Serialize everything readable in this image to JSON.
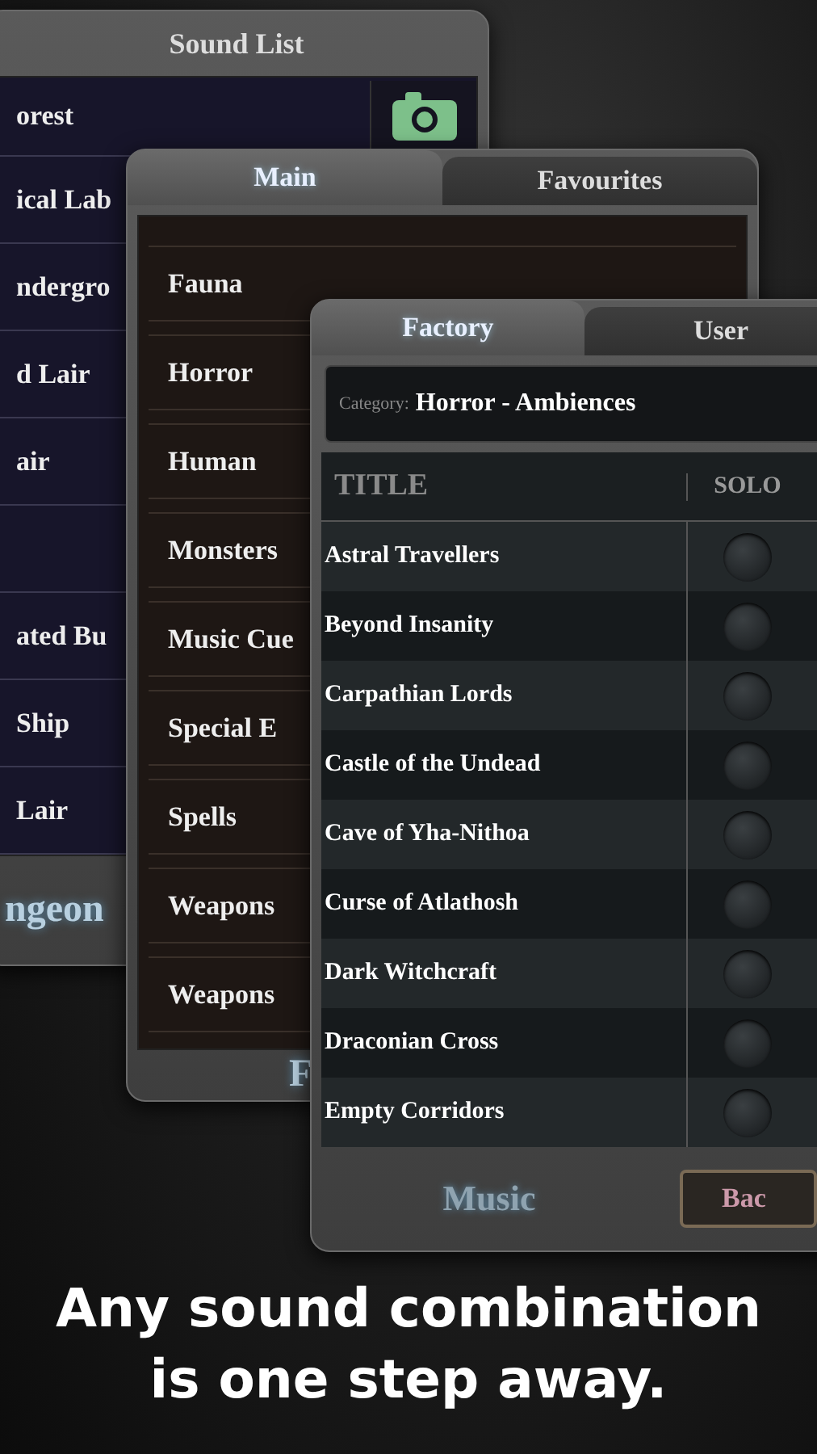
{
  "sound_list": {
    "title": "Sound List",
    "sections": [
      [
        "orest",
        "ical Lab",
        "ndergro",
        "d Lair",
        "air"
      ],
      [
        "ated Bu",
        "Ship",
        "Lair"
      ]
    ],
    "footer": "ngeon"
  },
  "category_panel": {
    "tabs": [
      {
        "label": "Main",
        "selected": true
      },
      {
        "label": "Favourites",
        "selected": false
      }
    ],
    "items": [
      "Fauna",
      "Horror",
      "Human",
      "Monsters",
      "Music Cue",
      "Special E",
      "Spells",
      "Weapons",
      "Weapons"
    ],
    "footer": "F"
  },
  "sounds_panel": {
    "tabs": [
      {
        "label": "Factory",
        "selected": true
      },
      {
        "label": "User",
        "selected": false
      }
    ],
    "category_label": "Category:",
    "category": "Horror - Ambiences",
    "columns": [
      "TITLE",
      "SOLO"
    ],
    "rows": [
      "Astral Travellers",
      "Beyond Insanity",
      "Carpathian Lords",
      "Castle of the Undead",
      "Cave of Yha-Nithoa",
      "Curse of Atlathosh",
      "Dark Witchcraft",
      "Draconian Cross",
      "Empty Corridors"
    ],
    "footer": "Music",
    "button": "Bac"
  },
  "caption": [
    "Any sound combination",
    "is one step away."
  ]
}
